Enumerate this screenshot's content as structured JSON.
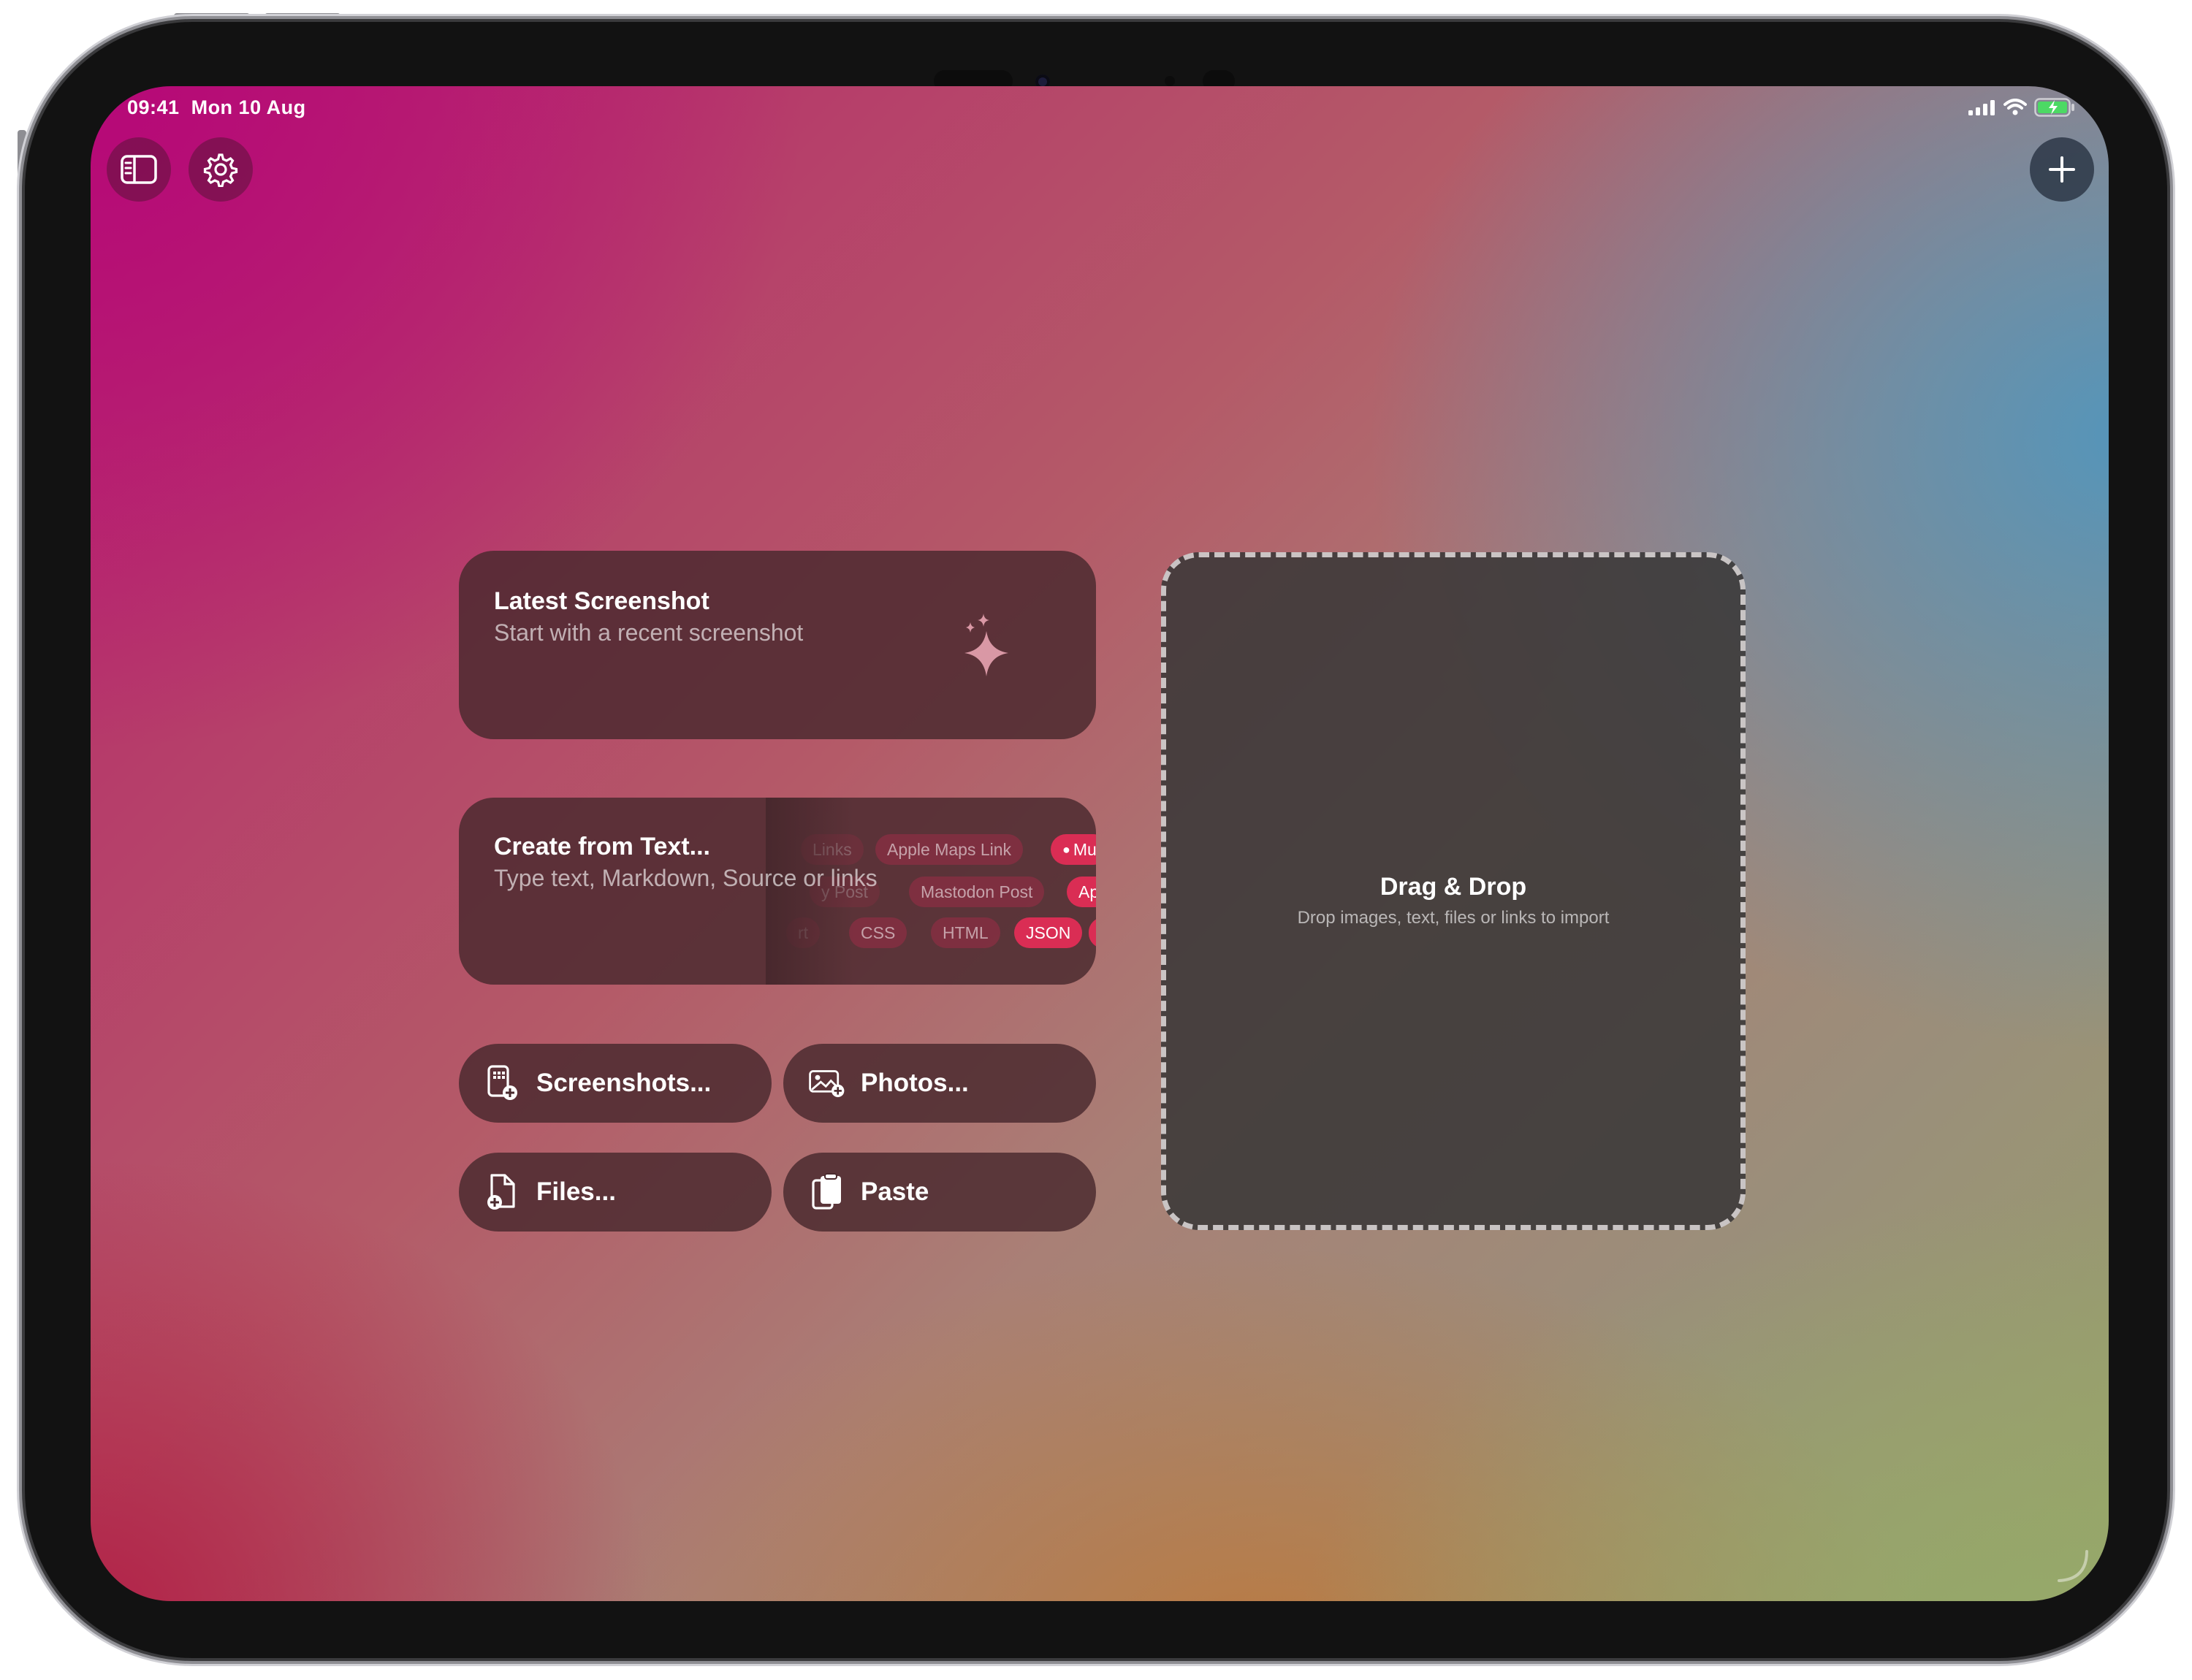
{
  "status_bar": {
    "time": "09:41",
    "date": "Mon 10 Aug"
  },
  "toolbar": {
    "sidebar_icon": "sidebar-icon",
    "settings_icon": "gear-icon",
    "add_icon": "plus-icon"
  },
  "latest_screenshot": {
    "title": "Latest Screenshot",
    "subtitle": "Start with a recent screenshot",
    "icon": "sparkles-icon"
  },
  "create_from_text": {
    "title": "Create from Text...",
    "subtitle": "Type text, Markdown, Source or links",
    "tag_rows": [
      [
        "Links",
        "Apple Maps Link",
        "Mu"
      ],
      [
        "y Post",
        "Mastodon Post",
        "Ap"
      ],
      [
        "rt",
        "CSS",
        "HTML",
        "JSON",
        ""
      ]
    ]
  },
  "actions": {
    "screenshots": "Screenshots...",
    "photos": "Photos...",
    "files": "Files...",
    "paste": "Paste"
  },
  "drop_zone": {
    "title": "Drag & Drop",
    "subtitle": "Drop images, text, files or links to import"
  },
  "colors": {
    "accent_tag": "#e12d55",
    "card_bg": "#48282d",
    "drop_border": "#e1dcdc"
  }
}
